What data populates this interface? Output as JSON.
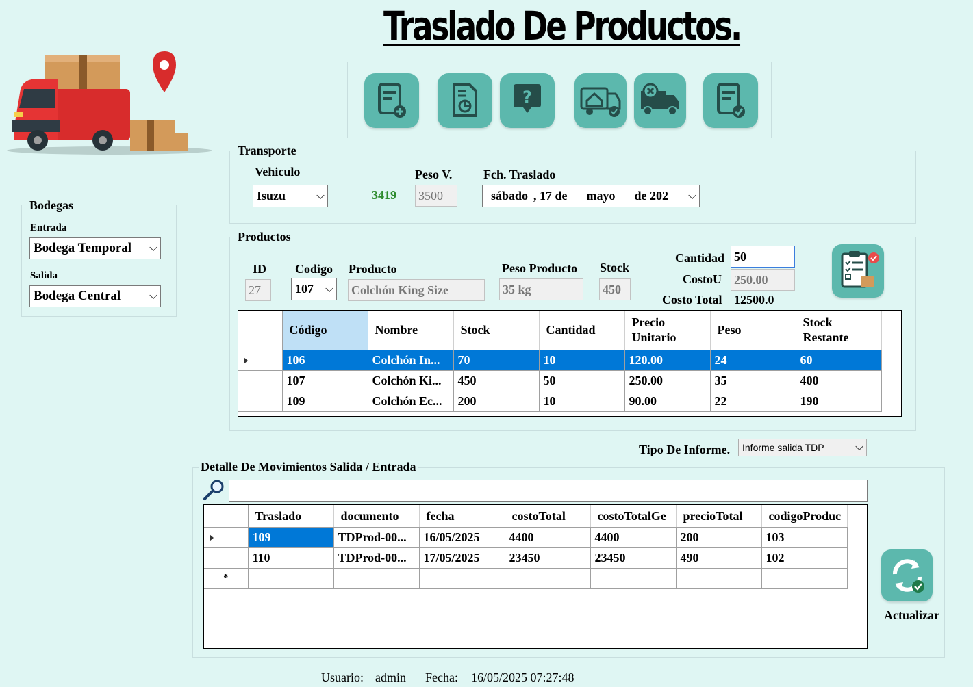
{
  "title": "Traslado De Productos.",
  "toolbar": {
    "buttons": [
      {
        "icon": "new-document-icon"
      },
      {
        "icon": "report-chart-icon"
      },
      {
        "icon": "help-icon"
      },
      {
        "icon": "truck-warehouse-icon"
      },
      {
        "icon": "truck-cancel-icon"
      },
      {
        "icon": "document-check-icon"
      }
    ]
  },
  "bodegas": {
    "title": "Bodegas",
    "entrada_label": "Entrada",
    "entrada_value": "Bodega Temporal",
    "salida_label": "Salida",
    "salida_value": "Bodega Central"
  },
  "transporte": {
    "title": "Transporte",
    "vehiculo_label": "Vehiculo",
    "vehiculo_value": "Isuzu",
    "capacity_value": "3419",
    "peso_label": "Peso V.",
    "peso_value": "3500",
    "fecha_label": "Fch. Traslado",
    "fecha_day": "sábado",
    "fecha_num": ", 17 de",
    "fecha_month": "mayo",
    "fecha_year": "de 202"
  },
  "productos": {
    "title": "Productos",
    "id_label": "ID",
    "id_value": "27",
    "codigo_label": "Codigo",
    "codigo_value": "107",
    "producto_label": "Producto",
    "producto_value": "Colchón King Size",
    "peso_label": "Peso Producto",
    "peso_value": "35 kg",
    "stock_label": "Stock",
    "stock_value": "450",
    "cantidad_label": "Cantidad",
    "cantidad_value": "50",
    "costo_label": "CostoU",
    "costo_value": "250.00",
    "total_label": "Costo Total",
    "total_value": "12500.0",
    "grid": {
      "headers": [
        "Código",
        "Nombre",
        "Stock",
        "Cantidad",
        "Precio Unitario",
        "Peso",
        "Stock Restante"
      ],
      "rows": [
        [
          "106",
          "Colchón In...",
          "70",
          "10",
          "120.00",
          "24",
          "60"
        ],
        [
          "107",
          "Colchón Ki...",
          "450",
          "50",
          "250.00",
          "35",
          "400"
        ],
        [
          "109",
          "Colchón Ec...",
          "200",
          "10",
          "90.00",
          "22",
          "190"
        ]
      ]
    }
  },
  "informe": {
    "label": "Tipo De Informe.",
    "value": "Informe salida TDP"
  },
  "detalle": {
    "title": "Detalle De Movimientos Salida / Entrada",
    "search_value": "",
    "grid": {
      "headers": [
        "Traslado",
        "documento",
        "fecha",
        "costoTotal",
        "costoTotalGe",
        "precioTotal",
        "codigoProduc"
      ],
      "rows": [
        [
          "109",
          "TDProd-00...",
          "16/05/2025",
          "4400",
          "4400",
          "200",
          "103"
        ],
        [
          "110",
          "TDProd-00...",
          "17/05/2025",
          "23450",
          "23450",
          "490",
          "102"
        ]
      ],
      "new_row_marker": "*"
    }
  },
  "actualizar_label": "Actualizar",
  "status": {
    "usuario_label": "Usuario:",
    "usuario_value": "admin",
    "fecha_label": "Fecha:",
    "fecha_value": "16/05/2025 07:27:48"
  },
  "colors": {
    "background": "#dff6f3",
    "button_teal": "#5cb8ad",
    "selection": "#0078d7",
    "capacity_green": "#2e8b2e"
  }
}
